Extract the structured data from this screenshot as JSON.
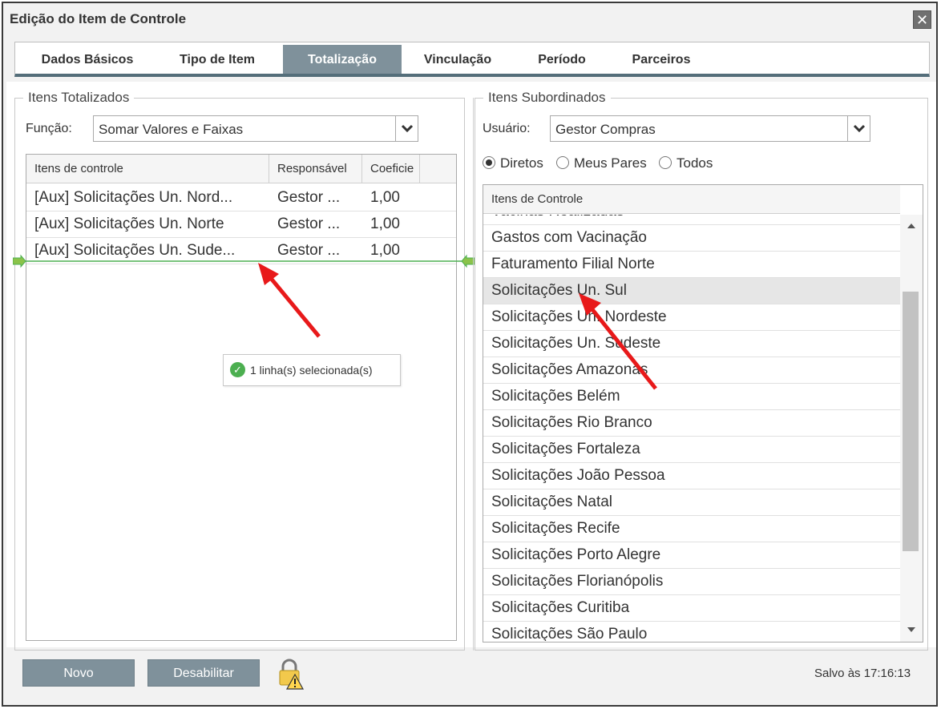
{
  "window": {
    "title": "Edição do Item de Controle",
    "close": "✕"
  },
  "tabs": [
    {
      "label": "Dados Básicos"
    },
    {
      "label": "Tipo de Item"
    },
    {
      "label": "Totalização"
    },
    {
      "label": "Vinculação"
    },
    {
      "label": "Período"
    },
    {
      "label": "Parceiros"
    }
  ],
  "active_tab": "Totalização",
  "left_panel": {
    "legend": "Itens Totalizados",
    "funcao_label": "Função:",
    "funcao_value": "Somar Valores e Faixas",
    "grid": {
      "headers": [
        "Itens de controle",
        "Responsável",
        "Coeficie"
      ],
      "rows": [
        [
          "[Aux] Solicitações Un. Nord...",
          "Gestor ...",
          "1,00"
        ],
        [
          "[Aux] Solicitações Un. Norte",
          "Gestor ...",
          "1,00"
        ],
        [
          "[Aux] Solicitações Un. Sude...",
          "Gestor ...",
          "1,00"
        ]
      ]
    },
    "selection_tooltip": "1 linha(s) selecionada(s)"
  },
  "right_panel": {
    "legend": "Itens Subordinados",
    "usuario_label": "Usuário:",
    "usuario_value": "Gestor Compras",
    "radios": [
      {
        "label": "Diretos",
        "checked": true
      },
      {
        "label": "Meus Pares",
        "checked": false
      },
      {
        "label": "Todos",
        "checked": false
      }
    ],
    "grid": {
      "header": "Itens de Controle",
      "partial_row": "Vacinas Realizadas",
      "rows": [
        "Gastos com Vacinação",
        "Faturamento Filial Norte",
        "Solicitações Un. Sul",
        "Solicitações Un. Nordeste",
        "Solicitações Un. Sudeste",
        "Solicitações Amazonas",
        "Solicitações Belém",
        "Solicitações Rio Branco",
        "Solicitações Fortaleza",
        "Solicitações João Pessoa",
        "Solicitações Natal",
        "Solicitações Recife",
        "Solicitações Porto Alegre",
        "Solicitações Florianópolis",
        "Solicitações Curitiba",
        "Solicitações São Paulo"
      ],
      "selected_row": "Solicitações Un. Sul"
    }
  },
  "footer": {
    "novo": "Novo",
    "desabilitar": "Desabilitar",
    "saved": "Salvo às 17:16:13"
  },
  "colors": {
    "accent": "#7f919b",
    "tab_underline": "#546e7a",
    "annotation_arrow": "#e8191a",
    "drop_indicator": "#4caf50"
  }
}
